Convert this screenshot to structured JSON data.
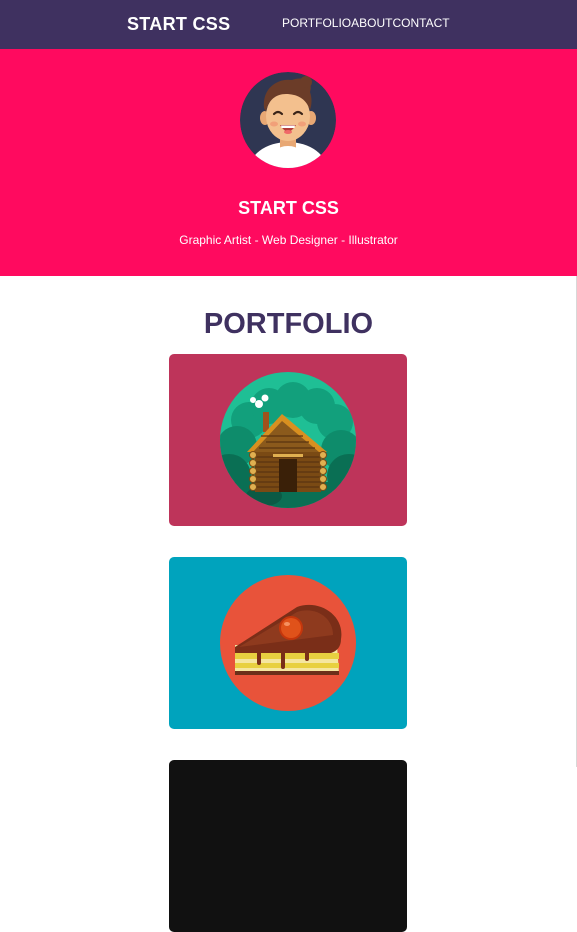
{
  "navbar": {
    "brand": "START CSS",
    "links": [
      "PORTFOLIO",
      "ABOUT",
      "CONTACT"
    ]
  },
  "hero": {
    "avatar_icon": "avatar-face-icon",
    "title": "START CSS",
    "subtitle": "Graphic Artist - Web Designer - Illustrator"
  },
  "portfolio": {
    "heading": "PORTFOLIO",
    "items": [
      {
        "icon": "log-cabin-icon",
        "bg": "#be345a"
      },
      {
        "icon": "cake-slice-icon",
        "bg": "#00a3bd"
      },
      {
        "icon": "item-icon",
        "bg": "#111111"
      }
    ]
  },
  "colors": {
    "nav_bg": "#3f3160",
    "hero_bg": "#ff0a5f",
    "heading": "#3f3160"
  }
}
